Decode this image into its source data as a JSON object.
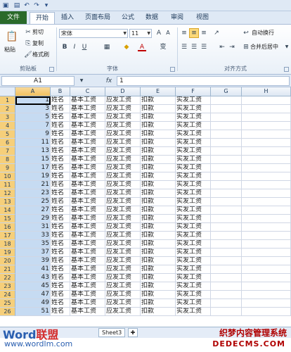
{
  "app": {
    "tabs": [
      {
        "label": "文件"
      },
      {
        "label": "开始"
      },
      {
        "label": "插入"
      },
      {
        "label": "页面布局"
      },
      {
        "label": "公式"
      },
      {
        "label": "数据"
      },
      {
        "label": "审阅"
      },
      {
        "label": "视图"
      }
    ],
    "active_tab": "开始",
    "colors": {
      "file_tab": "#2a6a2a",
      "selection": "#c6dbf2",
      "header_selected": "#f1c15f"
    }
  },
  "ribbon": {
    "clipboard": {
      "paste": "粘贴",
      "cut": "剪切",
      "copy": "复制",
      "format_painter": "格式刷",
      "group": "剪贴板"
    },
    "font": {
      "name": "宋体",
      "size": "11",
      "bold": "B",
      "italic": "I",
      "underline": "U",
      "group": "字体"
    },
    "alignment": {
      "wrap": "自动换行",
      "merge": "合并后居中",
      "group": "对齐方式"
    }
  },
  "formula": {
    "name_box": "A1",
    "fx": "fx",
    "value": "1"
  },
  "sheet": {
    "columns": [
      "A",
      "B",
      "C",
      "D",
      "E",
      "F",
      "G",
      "H"
    ],
    "rows": [
      {
        "n": "1",
        "a": "1",
        "b": "姓名",
        "c": "基本工资",
        "d": "应发工资",
        "e": "扣款",
        "f": "实发工资"
      },
      {
        "n": "2",
        "a": "3",
        "b": "姓名",
        "c": "基本工资",
        "d": "应发工资",
        "e": "扣款",
        "f": "实发工资"
      },
      {
        "n": "3",
        "a": "5",
        "b": "姓名",
        "c": "基本工资",
        "d": "应发工资",
        "e": "扣款",
        "f": "实发工资"
      },
      {
        "n": "4",
        "a": "7",
        "b": "姓名",
        "c": "基本工资",
        "d": "应发工资",
        "e": "扣款",
        "f": "实发工资"
      },
      {
        "n": "5",
        "a": "9",
        "b": "姓名",
        "c": "基本工资",
        "d": "应发工资",
        "e": "扣款",
        "f": "实发工资"
      },
      {
        "n": "6",
        "a": "11",
        "b": "姓名",
        "c": "基本工资",
        "d": "应发工资",
        "e": "扣款",
        "f": "实发工资"
      },
      {
        "n": "7",
        "a": "13",
        "b": "姓名",
        "c": "基本工资",
        "d": "应发工资",
        "e": "扣款",
        "f": "实发工资"
      },
      {
        "n": "8",
        "a": "15",
        "b": "姓名",
        "c": "基本工资",
        "d": "应发工资",
        "e": "扣款",
        "f": "实发工资"
      },
      {
        "n": "9",
        "a": "17",
        "b": "姓名",
        "c": "基本工资",
        "d": "应发工资",
        "e": "扣款",
        "f": "实发工资"
      },
      {
        "n": "10",
        "a": "19",
        "b": "姓名",
        "c": "基本工资",
        "d": "应发工资",
        "e": "扣款",
        "f": "实发工资"
      },
      {
        "n": "11",
        "a": "21",
        "b": "姓名",
        "c": "基本工资",
        "d": "应发工资",
        "e": "扣款",
        "f": "实发工资"
      },
      {
        "n": "12",
        "a": "23",
        "b": "姓名",
        "c": "基本工资",
        "d": "应发工资",
        "e": "扣款",
        "f": "实发工资"
      },
      {
        "n": "13",
        "a": "25",
        "b": "姓名",
        "c": "基本工资",
        "d": "应发工资",
        "e": "扣款",
        "f": "实发工资"
      },
      {
        "n": "14",
        "a": "27",
        "b": "姓名",
        "c": "基本工资",
        "d": "应发工资",
        "e": "扣款",
        "f": "实发工资"
      },
      {
        "n": "15",
        "a": "29",
        "b": "姓名",
        "c": "基本工资",
        "d": "应发工资",
        "e": "扣款",
        "f": "实发工资"
      },
      {
        "n": "16",
        "a": "31",
        "b": "姓名",
        "c": "基本工资",
        "d": "应发工资",
        "e": "扣款",
        "f": "实发工资"
      },
      {
        "n": "17",
        "a": "33",
        "b": "姓名",
        "c": "基本工资",
        "d": "应发工资",
        "e": "扣款",
        "f": "实发工资"
      },
      {
        "n": "18",
        "a": "35",
        "b": "姓名",
        "c": "基本工资",
        "d": "应发工资",
        "e": "扣款",
        "f": "实发工资"
      },
      {
        "n": "19",
        "a": "37",
        "b": "姓名",
        "c": "基本工资",
        "d": "应发工资",
        "e": "扣款",
        "f": "实发工资"
      },
      {
        "n": "20",
        "a": "39",
        "b": "姓名",
        "c": "基本工资",
        "d": "应发工资",
        "e": "扣款",
        "f": "实发工资"
      },
      {
        "n": "21",
        "a": "41",
        "b": "姓名",
        "c": "基本工资",
        "d": "应发工资",
        "e": "扣款",
        "f": "实发工资"
      },
      {
        "n": "22",
        "a": "43",
        "b": "姓名",
        "c": "基本工资",
        "d": "应发工资",
        "e": "扣款",
        "f": "实发工资"
      },
      {
        "n": "23",
        "a": "45",
        "b": "姓名",
        "c": "基本工资",
        "d": "应发工资",
        "e": "扣款",
        "f": "实发工资"
      },
      {
        "n": "24",
        "a": "47",
        "b": "姓名",
        "c": "基本工资",
        "d": "应发工资",
        "e": "扣款",
        "f": "实发工资"
      },
      {
        "n": "25",
        "a": "49",
        "b": "姓名",
        "c": "基本工资",
        "d": "应发工资",
        "e": "扣款",
        "f": "实发工资"
      },
      {
        "n": "26",
        "a": "51",
        "b": "姓名",
        "c": "基本工资",
        "d": "应发工资",
        "e": "扣款",
        "f": "实发工资"
      }
    ],
    "sheet_tab": "Sheet3"
  },
  "watermark": {
    "logo_main": "Word",
    "logo_accent": "联盟",
    "url": "www.wordlm.com",
    "right_title": "织梦内容管理系统",
    "right_url": "DEDECMS.COM"
  }
}
